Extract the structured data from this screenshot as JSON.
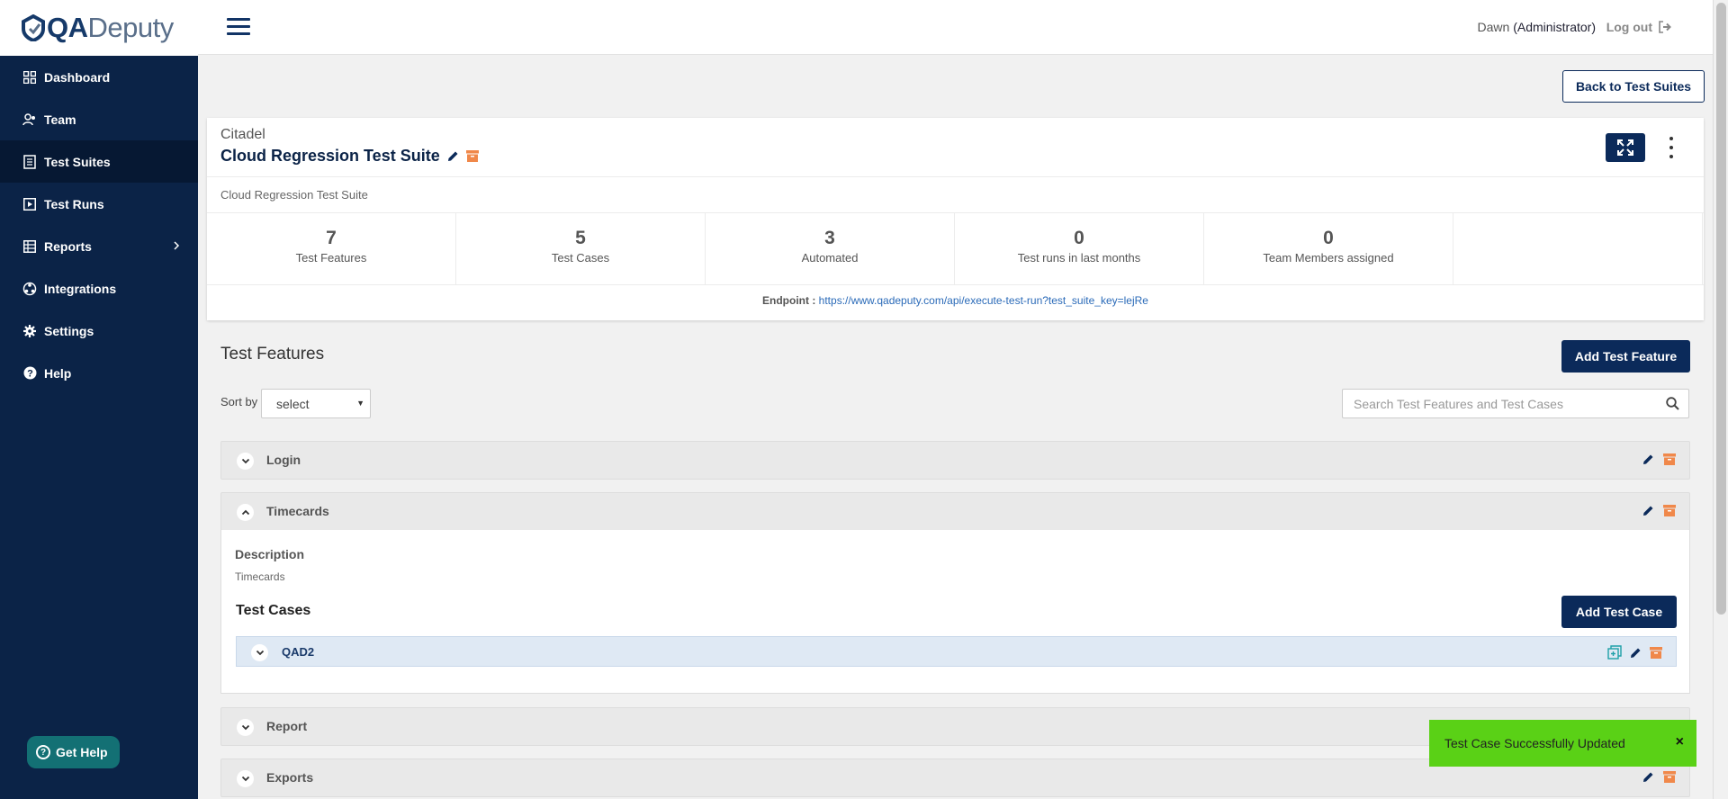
{
  "app": {
    "logo_qa": "QA",
    "logo_deputy": "Deputy"
  },
  "sidebar": {
    "items": [
      {
        "label": "Dashboard",
        "icon": "dashboard-icon"
      },
      {
        "label": "Team",
        "icon": "team-icon"
      },
      {
        "label": "Test Suites",
        "icon": "test-suites-icon",
        "active": true
      },
      {
        "label": "Test Runs",
        "icon": "play-icon"
      },
      {
        "label": "Reports",
        "icon": "table-icon"
      },
      {
        "label": "Integrations",
        "icon": "integrations-icon"
      },
      {
        "label": "Settings",
        "icon": "gear-icon"
      },
      {
        "label": "Help",
        "icon": "help-icon"
      }
    ],
    "get_help_label": "Get Help"
  },
  "topbar": {
    "user_name": "Dawn",
    "user_role": "(Administrator)",
    "logout_label": "Log out"
  },
  "back_button_label": "Back to Test Suites",
  "suite": {
    "project": "Citadel",
    "title": "Cloud Regression Test Suite",
    "description": "Cloud Regression Test Suite",
    "stats": [
      {
        "value": "7",
        "label": "Test Features"
      },
      {
        "value": "5",
        "label": "Test Cases"
      },
      {
        "value": "3",
        "label": "Automated"
      },
      {
        "value": "0",
        "label": "Test runs in last months"
      },
      {
        "value": "0",
        "label": "Team Members assigned"
      }
    ],
    "endpoint_label": "Endpoint :",
    "endpoint_url": "https://www.qadeputy.com/api/execute-test-run?test_suite_key=lejRe"
  },
  "features": {
    "section_title": "Test Features",
    "add_button_label": "Add Test Feature",
    "sort_label": "Sort by",
    "sort_value": "select",
    "search_placeholder": "Search Test Features and Test Cases",
    "items": [
      {
        "name": "Login"
      },
      {
        "name": "Timecards",
        "expanded": true
      },
      {
        "name": "Report"
      },
      {
        "name": "Exports"
      }
    ],
    "expanded": {
      "description_heading": "Description",
      "description": "Timecards",
      "test_cases_heading": "Test Cases",
      "add_case_label": "Add Test Case",
      "cases": [
        {
          "name": "QAD2"
        }
      ]
    }
  },
  "toast": {
    "message": "Test Case Successfully Updated",
    "close": "×"
  },
  "colors": {
    "sidebar": "#0b2347",
    "primary": "#0b2a5a",
    "archive": "#f0884a",
    "toast": "#5ad116"
  }
}
